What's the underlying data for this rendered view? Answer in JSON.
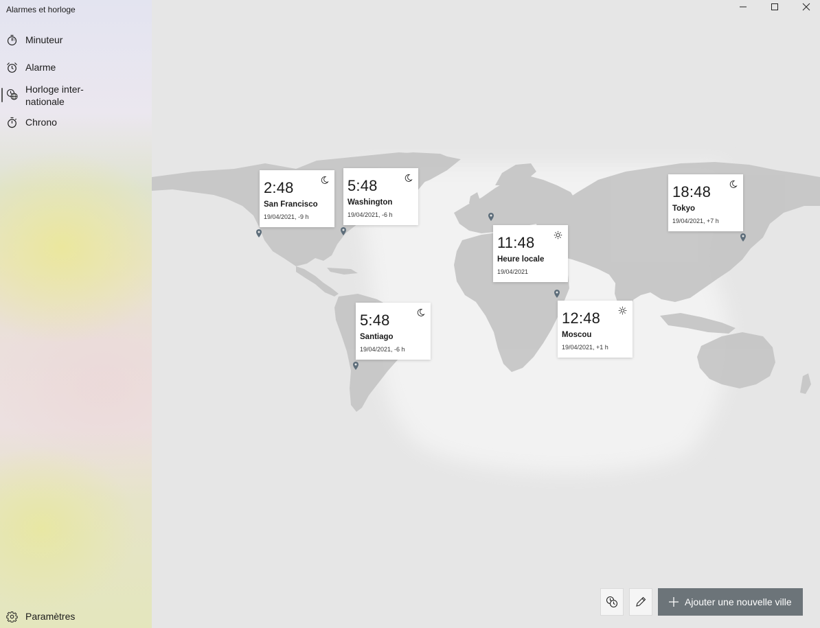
{
  "app": {
    "title": "Alarmes et horloge"
  },
  "sidebar": {
    "items": [
      {
        "label": "Minuteur",
        "icon": "timer-icon"
      },
      {
        "label": "Alarme",
        "icon": "alarm-clock-icon"
      },
      {
        "label_line1": "Horloge inter-",
        "label_line2": "nationale",
        "icon": "world-clock-icon",
        "selected": true
      },
      {
        "label": "Chrono",
        "icon": "stopwatch-icon"
      }
    ],
    "settings": {
      "label": "Paramètres",
      "icon": "gear-icon"
    }
  },
  "clocks": [
    {
      "time": "2:48",
      "city": "San Francisco",
      "date": "19/04/2021, -9 h",
      "daynight": "moon-icon"
    },
    {
      "time": "5:48",
      "city": "Washington",
      "date": "19/04/2021, -6 h",
      "daynight": "moon-icon"
    },
    {
      "time": "11:48",
      "city": "Heure locale",
      "date": "19/04/2021",
      "daynight": "sun-icon"
    },
    {
      "time": "18:48",
      "city": "Tokyo",
      "date": "19/04/2021, +7 h",
      "daynight": "moon-icon"
    },
    {
      "time": "5:48",
      "city": "Santiago",
      "date": "19/04/2021, -6 h",
      "daynight": "moon-icon"
    },
    {
      "time": "12:48",
      "city": "Moscou",
      "date": "19/04/2021, +1 h",
      "daynight": "sun-icon"
    }
  ],
  "toolbar": {
    "compare_icon": "compare-clocks-icon",
    "edit_icon": "pencil-icon",
    "add_label": "Ajouter une nouvelle ville",
    "add_icon": "plus-icon"
  },
  "window_controls": [
    "minimize-icon",
    "maximize-icon",
    "close-icon"
  ],
  "colors": {
    "accent": "#6c7479",
    "map_land": "#c9c9c9",
    "map_day": "#f0f0f0",
    "map_night": "#e3e3e3",
    "pin": "#5d6d7a"
  }
}
